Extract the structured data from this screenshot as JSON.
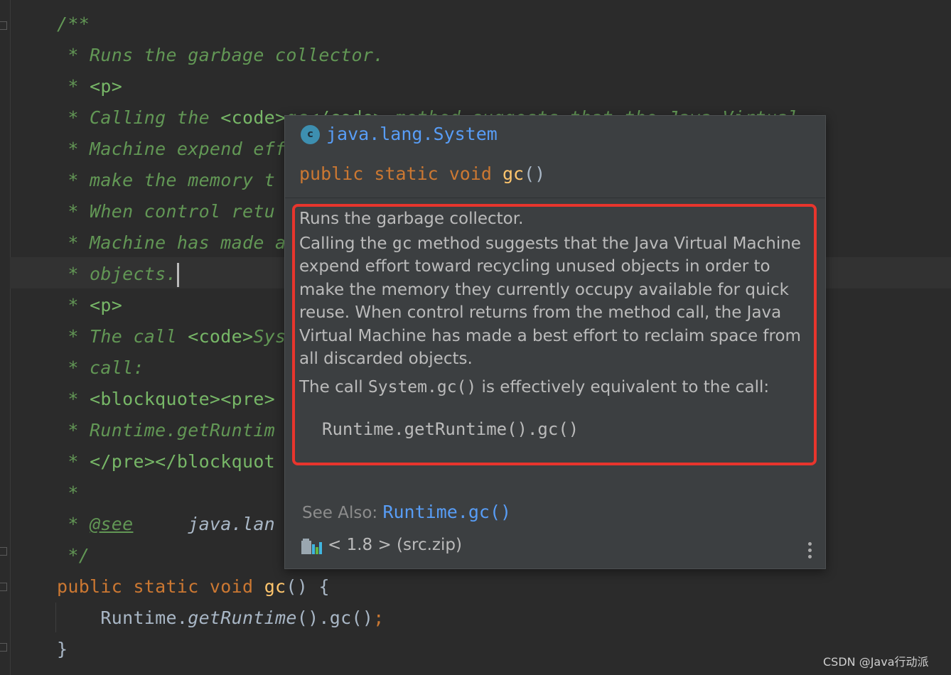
{
  "editor": {
    "code_lines": [
      {
        "segments": [
          {
            "cls": "doc",
            "text": "/**"
          }
        ]
      },
      {
        "segments": [
          {
            "cls": "doc",
            "text": " * Runs the garbage collector."
          }
        ]
      },
      {
        "segments": [
          {
            "cls": "doc",
            "text": " * "
          },
          {
            "cls": "doctag",
            "text": "<p>"
          }
        ]
      },
      {
        "segments": [
          {
            "cls": "doc",
            "text": " * Calling the "
          },
          {
            "cls": "doctag",
            "text": "<code>"
          },
          {
            "cls": "doc",
            "text": "gc"
          },
          {
            "cls": "doctag",
            "text": "</code>"
          },
          {
            "cls": "doc",
            "text": " method suggests that the Java Virtual"
          }
        ]
      },
      {
        "segments": [
          {
            "cls": "doc",
            "text": " * Machine expend effort toward recycling unused objects in order to"
          }
        ]
      },
      {
        "segments": [
          {
            "cls": "doc",
            "text": " * make the memory t"
          }
        ]
      },
      {
        "segments": [
          {
            "cls": "doc",
            "text": " * When control retu"
          }
        ]
      },
      {
        "segments": [
          {
            "cls": "doc",
            "text": " * Machine has made a best effort to reclaim space from all discarded"
          }
        ]
      },
      {
        "segments": [
          {
            "cls": "doc",
            "text": " * objects."
          }
        ],
        "caret": true
      },
      {
        "segments": [
          {
            "cls": "doc",
            "text": " * "
          },
          {
            "cls": "doctag",
            "text": "<p>"
          }
        ]
      },
      {
        "segments": [
          {
            "cls": "doc",
            "text": " * The call "
          },
          {
            "cls": "doctag",
            "text": "<code>"
          },
          {
            "cls": "doc",
            "text": "System.gc() is effectively equivalent to the"
          }
        ]
      },
      {
        "segments": [
          {
            "cls": "doc",
            "text": " * call:"
          }
        ]
      },
      {
        "segments": [
          {
            "cls": "doc",
            "text": " * "
          },
          {
            "cls": "doctag",
            "text": "<blockquote><pre>"
          }
        ]
      },
      {
        "segments": [
          {
            "cls": "doc",
            "text": " * Runtime.getRuntim"
          }
        ]
      },
      {
        "segments": [
          {
            "cls": "doc",
            "text": " * "
          },
          {
            "cls": "doctag-i",
            "text": "</pre></blockquot"
          }
        ]
      },
      {
        "segments": [
          {
            "cls": "doc",
            "text": " *"
          }
        ]
      },
      {
        "segments": [
          {
            "cls": "doc",
            "text": " * "
          },
          {
            "cls": "see",
            "text": "@see"
          },
          {
            "cls": "docref",
            "text": "     java.lan"
          }
        ]
      },
      {
        "segments": [
          {
            "cls": "doc",
            "text": " */"
          }
        ]
      },
      {
        "segments": [
          {
            "cls": "kw",
            "text": "public static void "
          },
          {
            "cls": "fn",
            "text": "gc"
          },
          {
            "cls": "plain",
            "text": "() {"
          }
        ]
      },
      {
        "segments": [
          {
            "cls": "plain",
            "text": "    Runtime."
          },
          {
            "cls": "plain ital",
            "text": "getRuntime"
          },
          {
            "cls": "plain",
            "text": "().gc()"
          },
          {
            "cls": "kw",
            "text": ";"
          }
        ]
      },
      {
        "segments": [
          {
            "cls": "plain",
            "text": "}"
          }
        ]
      }
    ]
  },
  "popup": {
    "class_icon_letter": "c",
    "class_name": "java.lang.System",
    "signature": {
      "modifiers": "public static void ",
      "method": "gc",
      "params": "()"
    },
    "description": "Runs the garbage collector.",
    "paragraph1": {
      "before": "Calling the ",
      "code": "gc",
      "after": " method suggests that the Java Virtual Machine expend effort toward recycling unused objects in order to make the memory they currently occupy available for quick reuse. When control returns from the method call, the Java Virtual Machine has made a best effort to reclaim space from all discarded objects."
    },
    "paragraph2": {
      "before": "The call ",
      "code": "System.gc()",
      "after": " is effectively equivalent to the call:"
    },
    "code_sample": "Runtime.getRuntime().gc()",
    "see_also_label": "See Also: ",
    "see_also_link": "Runtime.gc()",
    "library": "< 1.8 > (src.zip)",
    "more_icon": "more-vertical-icon",
    "library_icon": "library-icon",
    "highlight_color": "#e8352d"
  },
  "watermark": "CSDN @Java行动派"
}
